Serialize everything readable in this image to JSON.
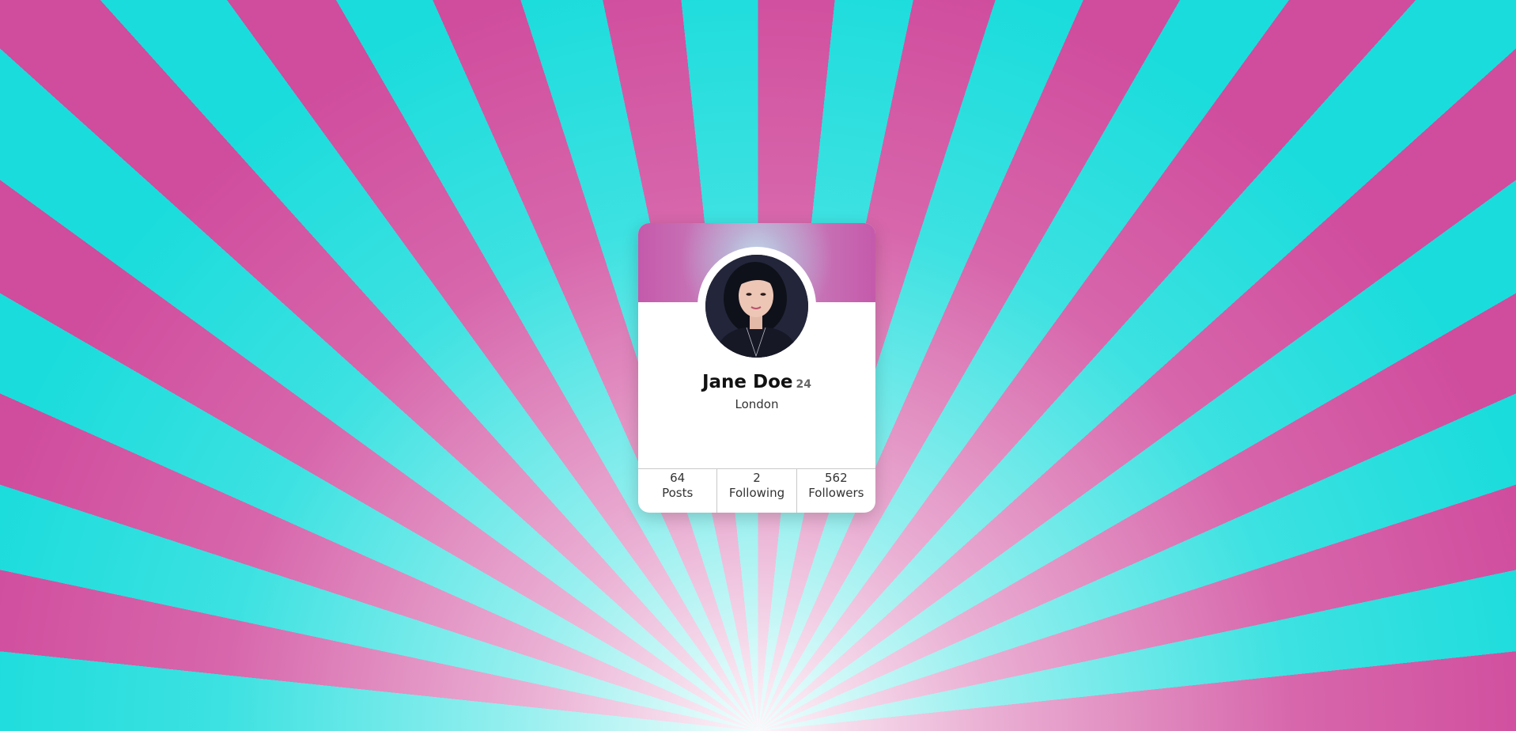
{
  "profile": {
    "name": "Jane Doe",
    "age": "24",
    "location": "London"
  },
  "stats": [
    {
      "value": "64",
      "label": "Posts"
    },
    {
      "value": "2",
      "label": "Following"
    },
    {
      "value": "562",
      "label": "Followers"
    }
  ],
  "colors": {
    "pink": "#d04c9d",
    "cyan": "#1bdcdc",
    "card": "#ffffff"
  }
}
